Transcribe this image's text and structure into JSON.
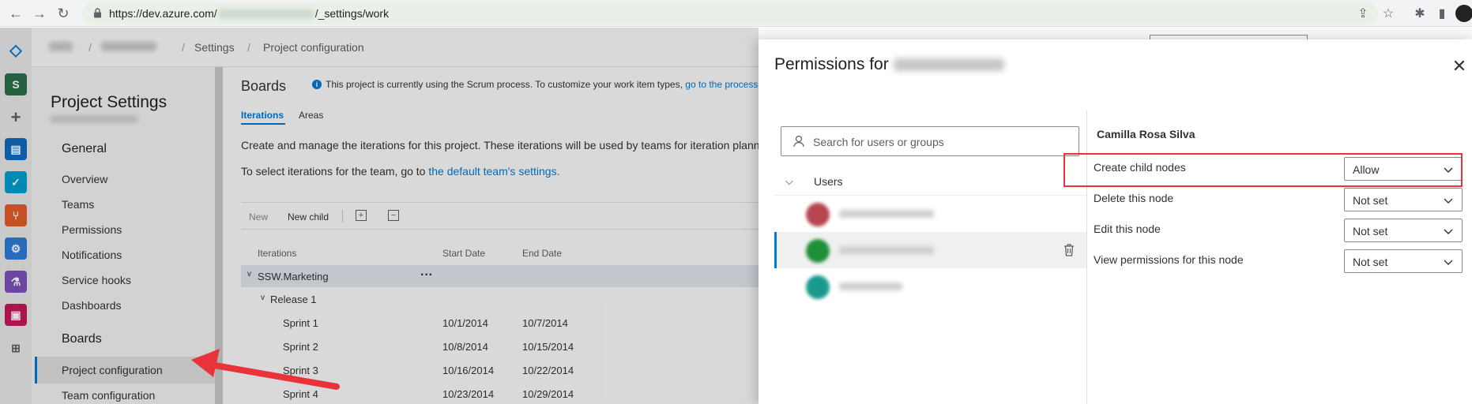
{
  "browser": {
    "url_prefix": "https://dev.azure.com/",
    "url_suffix": "/_settings/work"
  },
  "breadcrumb": {
    "settings": "Settings",
    "project_configuration": "Project configuration"
  },
  "rail": {
    "org_letter": "S"
  },
  "settings_nav": {
    "title": "Project Settings",
    "general_group": "General",
    "general_items": [
      "Overview",
      "Teams",
      "Permissions",
      "Notifications",
      "Service hooks",
      "Dashboards"
    ],
    "boards_group": "Boards",
    "boards_items": [
      "Project configuration",
      "Team configuration"
    ]
  },
  "main": {
    "heading": "Boards",
    "info_banner": "This project is currently using the Scrum process. To customize your work item types,",
    "info_link": "go to the process c",
    "tabs": [
      "Iterations",
      "Areas"
    ],
    "description": "Create and manage the iterations for this project. These iterations will be used by teams for iteration plann",
    "team_text": "To select iterations for the team, go to",
    "team_link": "the default team's settings.",
    "toolbar": {
      "new": "New",
      "new_child": "New child"
    },
    "columns": {
      "iterations": "Iterations",
      "start": "Start Date",
      "end": "End Date"
    },
    "root_node": "SSW.Marketing",
    "release_node": "Release 1",
    "sprints": [
      {
        "name": "Sprint 1",
        "start": "10/1/2014",
        "end": "10/7/2014"
      },
      {
        "name": "Sprint 2",
        "start": "10/8/2014",
        "end": "10/15/2014"
      },
      {
        "name": "Sprint 3",
        "start": "10/16/2014",
        "end": "10/22/2014"
      },
      {
        "name": "Sprint 4",
        "start": "10/23/2014",
        "end": "10/29/2014"
      }
    ]
  },
  "panel": {
    "title_prefix": "Permissions for",
    "search_placeholder": "Search for users or groups",
    "users_group_label": "Users",
    "selected_user": "Camilla Rosa Silva",
    "permissions": [
      {
        "label": "Create child nodes",
        "value": "Allow"
      },
      {
        "label": "Delete this node",
        "value": "Not set"
      },
      {
        "label": "Edit this node",
        "value": "Not set"
      },
      {
        "label": "View permissions for this node",
        "value": "Not set"
      }
    ]
  },
  "colors": {
    "accent": "#0078d4",
    "highlight": "#e8333a",
    "arrow": "#e8333a"
  }
}
